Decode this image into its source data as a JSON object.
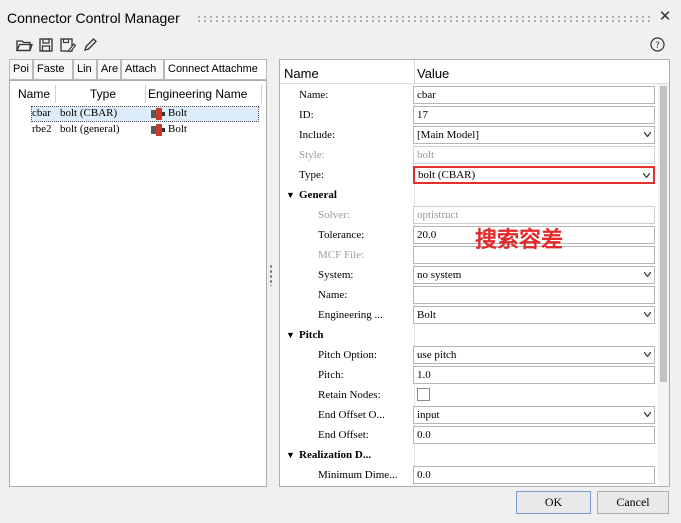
{
  "window": {
    "title": "Connector Control Manager"
  },
  "toolbar": {
    "icons": [
      "open-folder-icon",
      "save-icon",
      "save-as-icon",
      "edit-pencil-icon"
    ],
    "help_icon": "help-icon"
  },
  "left": {
    "tabs": [
      "Poi",
      "Faste",
      "Lin",
      "Are",
      "Attach",
      "Connect Attachme"
    ],
    "columns": {
      "name": "Name",
      "type": "Type",
      "eng": "Engineering Name"
    },
    "rows": [
      {
        "name": "cbar",
        "type": "bolt (CBAR)",
        "eng": "Bolt"
      },
      {
        "name": "rbe2",
        "type": "bolt (general)",
        "eng": "Bolt"
      }
    ]
  },
  "right": {
    "columns": {
      "name": "Name",
      "value": "Value"
    },
    "props": {
      "name": {
        "label": "Name:",
        "value": "cbar"
      },
      "id": {
        "label": "ID:",
        "value": "17"
      },
      "include": {
        "label": "Include:",
        "value": "[Main Model]"
      },
      "style": {
        "label": "Style:",
        "value": "bolt"
      },
      "type": {
        "label": "Type:",
        "value": "bolt (CBAR)"
      }
    },
    "general": {
      "title": "General",
      "solver": {
        "label": "Solver:",
        "value": "optistruct"
      },
      "tolerance": {
        "label": "Tolerance:",
        "value": "20.0"
      },
      "mcf": {
        "label": "MCF File:",
        "value": ""
      },
      "system": {
        "label": "System:",
        "value": "no system"
      },
      "name": {
        "label": "Name:",
        "value": ""
      },
      "engineering": {
        "label": "Engineering ...",
        "value": "Bolt"
      }
    },
    "pitch": {
      "title": "Pitch",
      "option": {
        "label": "Pitch Option:",
        "value": "use pitch"
      },
      "pitch": {
        "label": "Pitch:",
        "value": "1.0"
      },
      "retain": {
        "label": "Retain Nodes:"
      },
      "end_offset_opt": {
        "label": "End Offset O...",
        "value": "input"
      },
      "end_offset": {
        "label": "End Offset:",
        "value": "0.0"
      }
    },
    "realization": {
      "title": "Realization D...",
      "min_dim": {
        "label": "Minimum Dime...",
        "value": "0.0"
      }
    }
  },
  "annotation": {
    "text": "搜索容差",
    "color": "#e22a2a"
  },
  "buttons": {
    "ok": "OK",
    "cancel": "Cancel"
  },
  "colors": {
    "highlight_border": "#e03030",
    "selection": "#dcecfb"
  }
}
